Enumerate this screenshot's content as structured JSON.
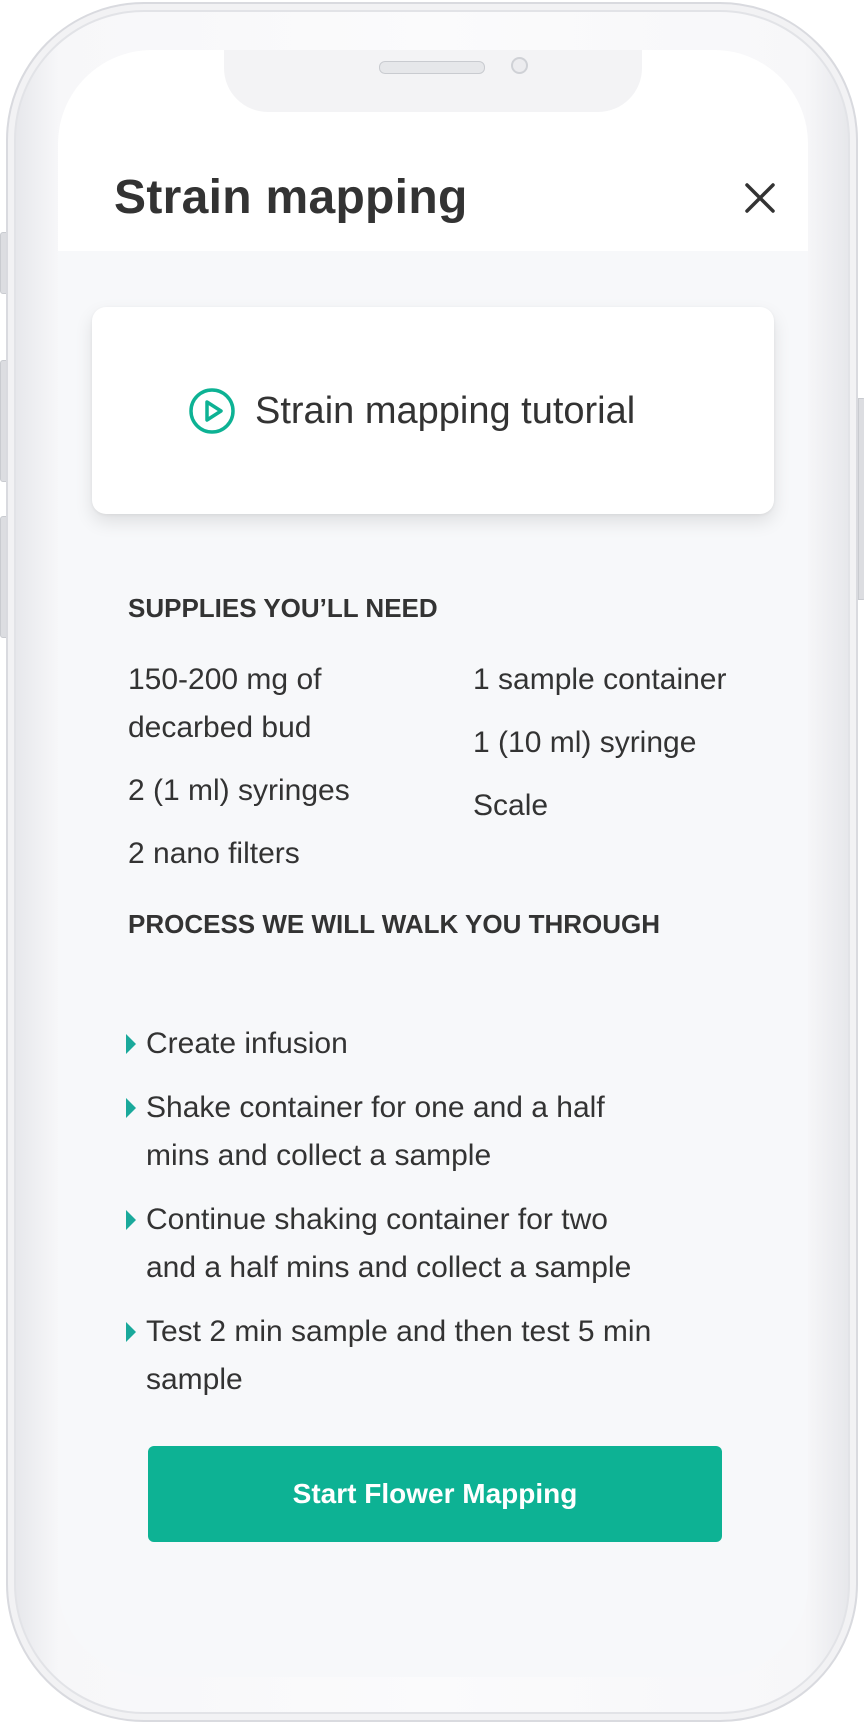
{
  "header": {
    "title": "Strain mapping"
  },
  "tutorial": {
    "label": "Strain mapping tutorial",
    "icon": "play-circle-icon"
  },
  "supplies": {
    "heading": "SUPPLIES YOU’LL NEED",
    "left": [
      "150-200 mg of decarbed bud",
      "2 (1 ml) syringes",
      "2 nano filters"
    ],
    "right": [
      "1 sample container",
      "1 (10 ml) syringe",
      "Scale"
    ]
  },
  "process": {
    "heading": "PROCESS WE WILL WALK YOU THROUGH",
    "steps": [
      "Create infusion",
      "Shake container for one and a half mins and collect a sample",
      "Continue shaking container for two and a half mins and collect a sample",
      "Test 2 min sample and then test 5 min sample"
    ]
  },
  "cta": {
    "label": "Start Flower Mapping"
  },
  "colors": {
    "accent": "#0db294",
    "text": "#333333",
    "background": "#f7f8fa"
  }
}
